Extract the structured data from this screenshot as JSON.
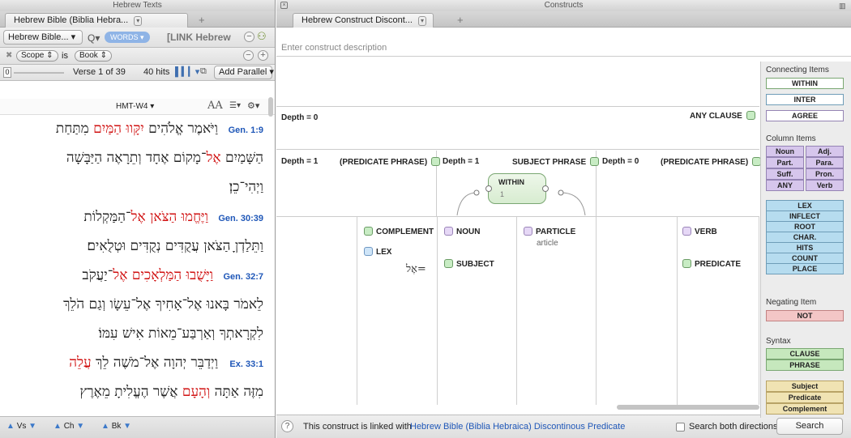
{
  "left_window": {
    "title": "Hebrew Texts",
    "tab_label": "Hebrew Bible (Biblia Hebra...",
    "resource_button": "Hebrew Bible...",
    "search_chip": "WORDS",
    "search_value": "[LINK Hebrew",
    "filter_scope": "Scope",
    "filter_is": "is",
    "filter_book": "Book",
    "verse_input": "0",
    "verse_label": "Verse 1 of 39",
    "hits_label": "40 hits",
    "add_parallel": "Add Parallel",
    "text_version": "HMT-W4",
    "font_size_label": "AA",
    "nav_vs": "Vs",
    "nav_ch": "Ch",
    "nav_bk": "Bk",
    "lines": [
      {
        "ref": "Gen. 1:9",
        "pre": "וַיֹּאמֶר אֱלֹהִים ",
        "red": "יִקָּווּ הַמַּיִם",
        "post": " מִתַּחַת"
      },
      {
        "ref": "",
        "pre": "הַשָּׁמַיִם ",
        "red": "אֶל",
        "post": "־מָקוֹם אֶחָד וְתֵרָאֶה הַיַּבָּשָׁה"
      },
      {
        "ref": "",
        "pre": "וַיְהִי־כֵן׃",
        "red": "",
        "post": ""
      },
      {
        "ref": "Gen. 30:39",
        "pre": "",
        "red": "וַיֶּחֱמוּ הַצֹּאן אֶל",
        "post": "־הַמַּקְלוֹת"
      },
      {
        "ref": "",
        "pre": "וַתֵּלַדְןָ הַצֹּאן עֲקֻדִּים נְקֻדִּים וּטְלֻאִים׃",
        "red": "",
        "post": ""
      },
      {
        "ref": "Gen. 32:7",
        "pre": "",
        "red": "וַיָּשֻׁבוּ הַמַּלְאָכִים אֶל",
        "post": "־יַעֲקֹב"
      },
      {
        "ref": "",
        "pre": "לֵאמֹר בָּאנוּ אֶל־אָחִיךָ אֶל־עֵשָׂו וְגַם הֹלֵךְ",
        "red": "",
        "post": ""
      },
      {
        "ref": "",
        "pre": "לִקְרָאתְךָ וְאַרְבַּע־מֵאוֹת אִישׁ עִמּוֹ׃",
        "red": "",
        "post": ""
      },
      {
        "ref": "Ex. 33:1",
        "pre": "וַיְדַבֵּר יְהוָה אֶל־מֹשֶׁה לֵךְ ",
        "red": "עֲלֵה",
        "post": ""
      },
      {
        "ref": "",
        "pre": "מִזֶּה אַתָּה ",
        "red": "וְהָעָם",
        "post": " אֲשֶׁר הֶעֱלִיתָ מֵאֶרֶץ"
      }
    ]
  },
  "right_window": {
    "title": "Constructs",
    "tab_label": "Hebrew Construct Discont...",
    "description_placeholder": "Enter construct description",
    "row0": {
      "depth": "Depth = 0",
      "label": "ANY CLAUSE"
    },
    "row1": [
      {
        "depth": "Depth = 1",
        "label": "(PREDICATE PHRASE)"
      },
      {
        "depth": "Depth = 1",
        "label": "SUBJECT PHRASE"
      },
      {
        "depth": "Depth = 0",
        "label": "(PREDICATE PHRASE)"
      }
    ],
    "within_node": {
      "label": "WITHIN",
      "value": "1"
    },
    "items": {
      "complement": "COMPLEMENT",
      "lex": "LEX",
      "lex_value": "=אֶל",
      "noun": "NOUN",
      "subject": "SUBJECT",
      "particle": "PARTICLE",
      "particle_sub": "article",
      "verb": "VERB",
      "predicate": "PREDICATE"
    },
    "status_text": "This construct is linked with",
    "status_link": "Hebrew Bible (Biblia Hebraica) Discontinous Predicate",
    "search_both": "Search both directions",
    "search_button": "Search"
  },
  "palette": {
    "connecting_title": "Connecting Items",
    "connecting": [
      "WITHIN",
      "INTER",
      "AGREE"
    ],
    "column_title": "Column Items",
    "column_grid": [
      "Noun",
      "Adj.",
      "Part.",
      "Para.",
      "Suff.",
      "Pron.",
      "ANY",
      "Verb"
    ],
    "column_list": [
      "LEX",
      "INFLECT",
      "ROOT",
      "CHAR.",
      "HITS",
      "COUNT",
      "PLACE"
    ],
    "negating_title": "Negating Item",
    "negating": [
      "NOT"
    ],
    "syntax_title": "Syntax",
    "syntax_a": [
      "CLAUSE",
      "PHRASE"
    ],
    "syntax_b": [
      "Subject",
      "Predicate",
      "Complement"
    ]
  },
  "colors": {
    "accent_red": "#d01010",
    "link_blue": "#1f57b8"
  }
}
